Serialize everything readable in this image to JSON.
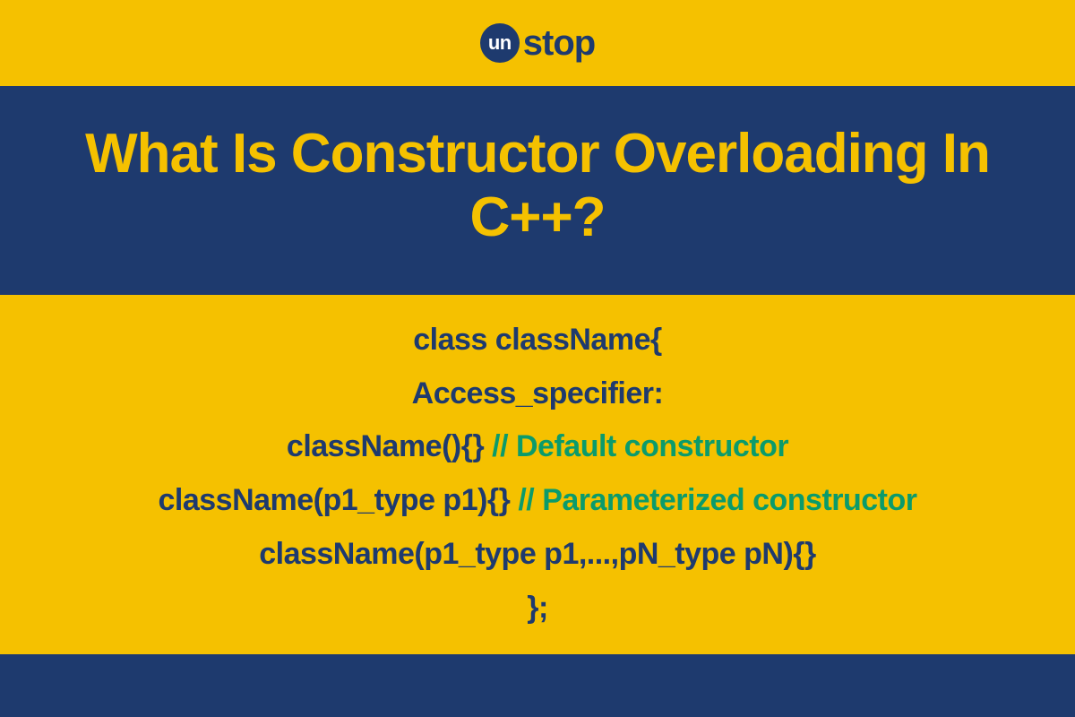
{
  "logo": {
    "circle_text": "un",
    "rest_text": "stop"
  },
  "title": "What Is Constructor Overloading In C++?",
  "code": {
    "l1": "class className{",
    "l2": "Access_specifier:",
    "l3a": "className(){} ",
    "l3b": "// Default constructor",
    "l4a": "className(p1_type p1){} ",
    "l4b": "// Parameterized constructor",
    "l5": "className(p1_type p1,...,pN_type pN){}",
    "l6": "};"
  },
  "colors": {
    "bg_yellow": "#f5c100",
    "band_navy": "#1e3a6e",
    "comment_green": "#0b9b6b"
  }
}
